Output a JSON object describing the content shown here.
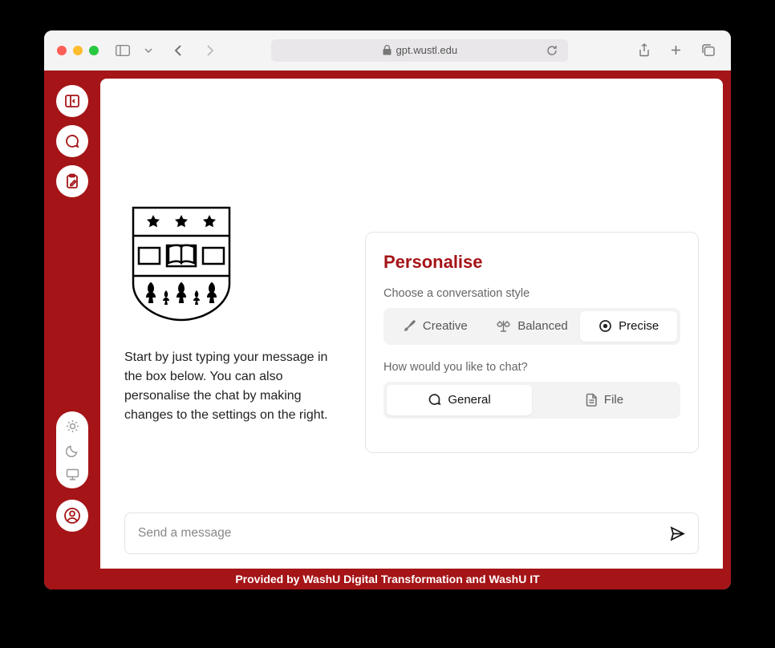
{
  "browser": {
    "url": "gpt.wustl.edu"
  },
  "intro": "Start by just typing your message in the box below. You can also personalise the chat by making changes to the settings on the right.",
  "personalise": {
    "title": "Personalise",
    "style_label": "Choose a conversation style",
    "styles": {
      "creative": "Creative",
      "balanced": "Balanced",
      "precise": "Precise"
    },
    "mode_label": "How would you like to chat?",
    "modes": {
      "general": "General",
      "file": "File"
    }
  },
  "input": {
    "placeholder": "Send a message"
  },
  "footer": "Provided by WashU Digital Transformation and WashU IT"
}
